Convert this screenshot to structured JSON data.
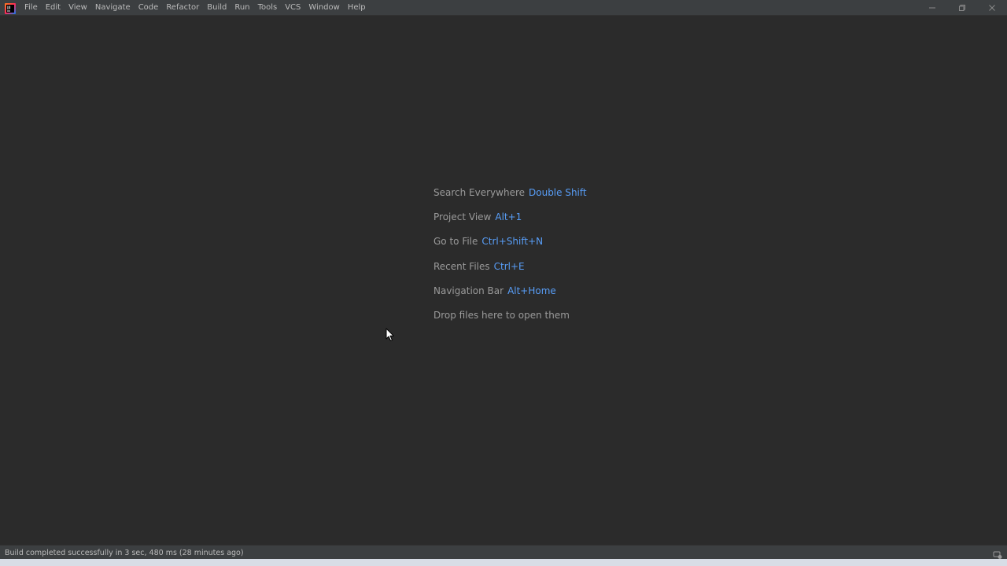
{
  "menubar": {
    "items": [
      "File",
      "Edit",
      "View",
      "Navigate",
      "Code",
      "Refactor",
      "Build",
      "Run",
      "Tools",
      "VCS",
      "Window",
      "Help"
    ]
  },
  "hints": [
    {
      "label": "Search Everywhere",
      "shortcut": "Double Shift"
    },
    {
      "label": "Project View",
      "shortcut": "Alt+1"
    },
    {
      "label": "Go to File",
      "shortcut": "Ctrl+Shift+N"
    },
    {
      "label": "Recent Files",
      "shortcut": "Ctrl+E"
    },
    {
      "label": "Navigation Bar",
      "shortcut": "Alt+Home"
    },
    {
      "label": "Drop files here to open them",
      "shortcut": ""
    }
  ],
  "statusbar": {
    "message": "Build completed successfully in 3 sec, 480 ms (28 minutes ago)"
  },
  "colors": {
    "background": "#2b2b2b",
    "chrome": "#3c3f41",
    "hint_label": "#9a9a9a",
    "hint_shortcut": "#589df6"
  }
}
